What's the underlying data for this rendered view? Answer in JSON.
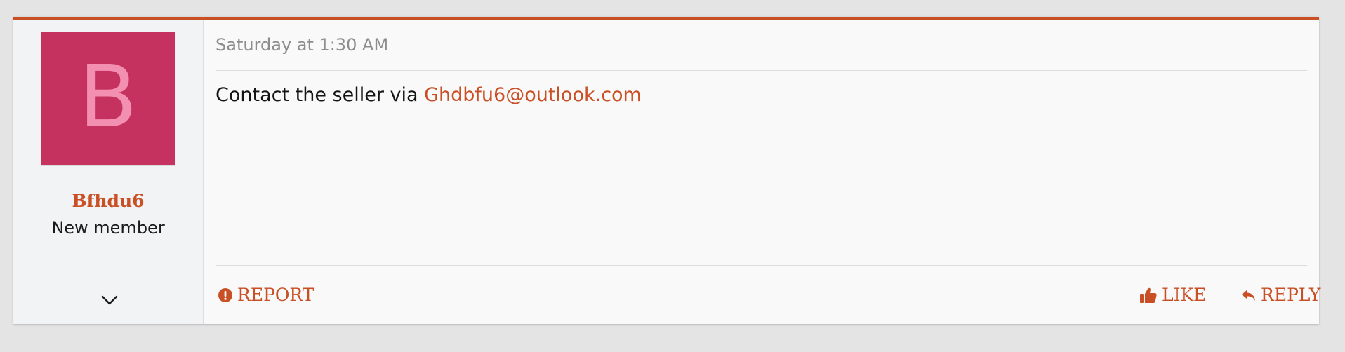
{
  "post": {
    "author": {
      "avatar_letter": "B",
      "avatar_bg_color": "#c6325f",
      "avatar_letter_color": "#f38fb1",
      "username": "Bfhdu6",
      "user_title": "New member",
      "expand_icon": "chevron-down-icon"
    },
    "date": "Saturday at 1:30 AM",
    "message": {
      "prefix": "Contact the seller via ",
      "email": "Ghdbfu6@outlook.com"
    },
    "actions": {
      "report_label": "REPORT",
      "report_icon": "exclamation-circle-icon",
      "like_label": "LIKE",
      "like_icon": "thumbs-up-icon",
      "reply_label": "REPLY",
      "reply_icon": "reply-arrow-icon"
    },
    "accent_color": "#c94f25"
  }
}
